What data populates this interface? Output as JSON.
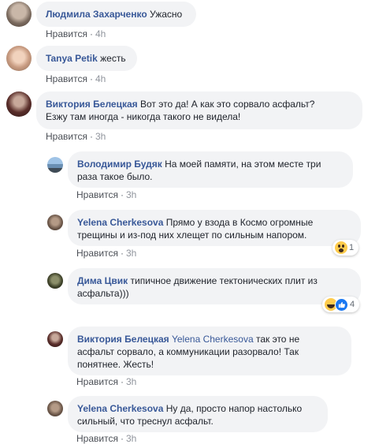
{
  "like_label": "Нравится",
  "comments": [
    {
      "name": "Людмила Захарченко",
      "text": "Ужасно",
      "time": "4h"
    },
    {
      "name": "Tanya Petik",
      "text": "жесть",
      "time": "4h"
    },
    {
      "name": "Виктория Белецкая",
      "text_lines": [
        "Вот это да! А как это сорвало асфальт?",
        "Езжу там иногда - никогда такого не видела!"
      ],
      "time": "3h"
    },
    {
      "name": "Володимир Будяк",
      "line1": "На моей памяти, на этом месте три",
      "line2": "раза такое было.",
      "time": "3h"
    },
    {
      "name": "Yelena Cherkesova",
      "line1": "Прямо у взода в Космо огромные",
      "line2": "трещины и из-под них хлещет по сильным напором.",
      "time": "3h",
      "reaction_count": "1"
    },
    {
      "name": "Дима Цвик",
      "line1": "типичное движение тектонических плит из",
      "line2": "асфальта)))",
      "time": "3h",
      "reaction_count": "4"
    },
    {
      "name": "Виктория Белецкая",
      "tag": "Yelena Cherkesova",
      "line1": "так это не",
      "line2": "асфальт сорвало, а коммуникации разорвало! Так",
      "line3": "понятнее. Жесть!",
      "time": "3h"
    },
    {
      "name": "Yelena Cherkesova",
      "line1": "Ну да, просто напор настолько",
      "line2": "сильный, что треснул асфальт.",
      "time": "3h"
    }
  ]
}
